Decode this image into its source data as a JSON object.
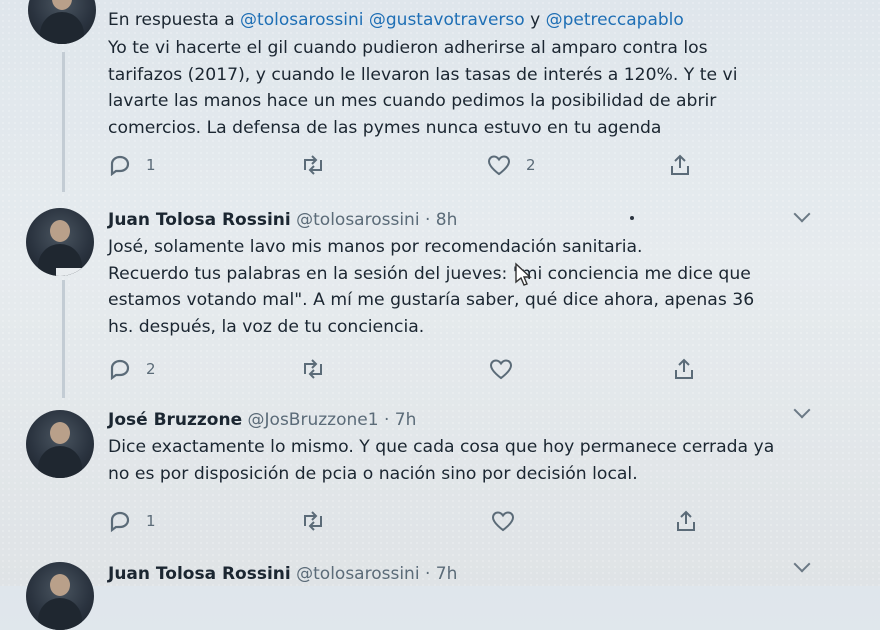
{
  "tweets": [
    {
      "reply_prefix": "En respuesta a",
      "reply_mentions": [
        "@tolosarossini",
        "@gustavotraverso",
        "@petreccapablo"
      ],
      "reply_joiner": "y",
      "text_lines": [
        "Yo te vi hacerte el gil cuando pudieron adherirse al amparo contra los",
        "tarifazos (2017), y cuando le llevaron las tasas de interés a 120%. Y te vi",
        "lavarte las manos hace un mes cuando pedimos la posibilidad de abrir",
        "comercios. La defensa de las pymes nunca estuvo en tu agenda"
      ],
      "reply_count": "1",
      "retweet_count": "",
      "like_count": "2"
    },
    {
      "name": "Juan Tolosa Rossini",
      "handle": "@tolosarossini",
      "separator": "·",
      "time": "8h",
      "text_lines": [
        "José, solamente lavo mis manos por recomendación sanitaria.",
        "Recuerdo tus palabras en la sesión del jueves: \"mi conciencia me dice que",
        "estamos votando mal\". A mí me gustaría saber, qué dice ahora, apenas 36",
        "hs. después, la voz de tu conciencia."
      ],
      "reply_count": "2",
      "retweet_count": "",
      "like_count": ""
    },
    {
      "name": "José Bruzzone",
      "handle": "@JosBruzzone1",
      "separator": "·",
      "time": "7h",
      "text_lines": [
        "Dice exactamente lo mismo. Y que cada cosa que hoy permanece cerrada ya",
        "no es por disposición de pcia o nación sino por decisión local."
      ],
      "reply_count": "1",
      "retweet_count": "",
      "like_count": ""
    },
    {
      "name": "Juan Tolosa Rossini",
      "handle": "@tolosarossini",
      "separator": "·",
      "time": "7h"
    }
  ]
}
